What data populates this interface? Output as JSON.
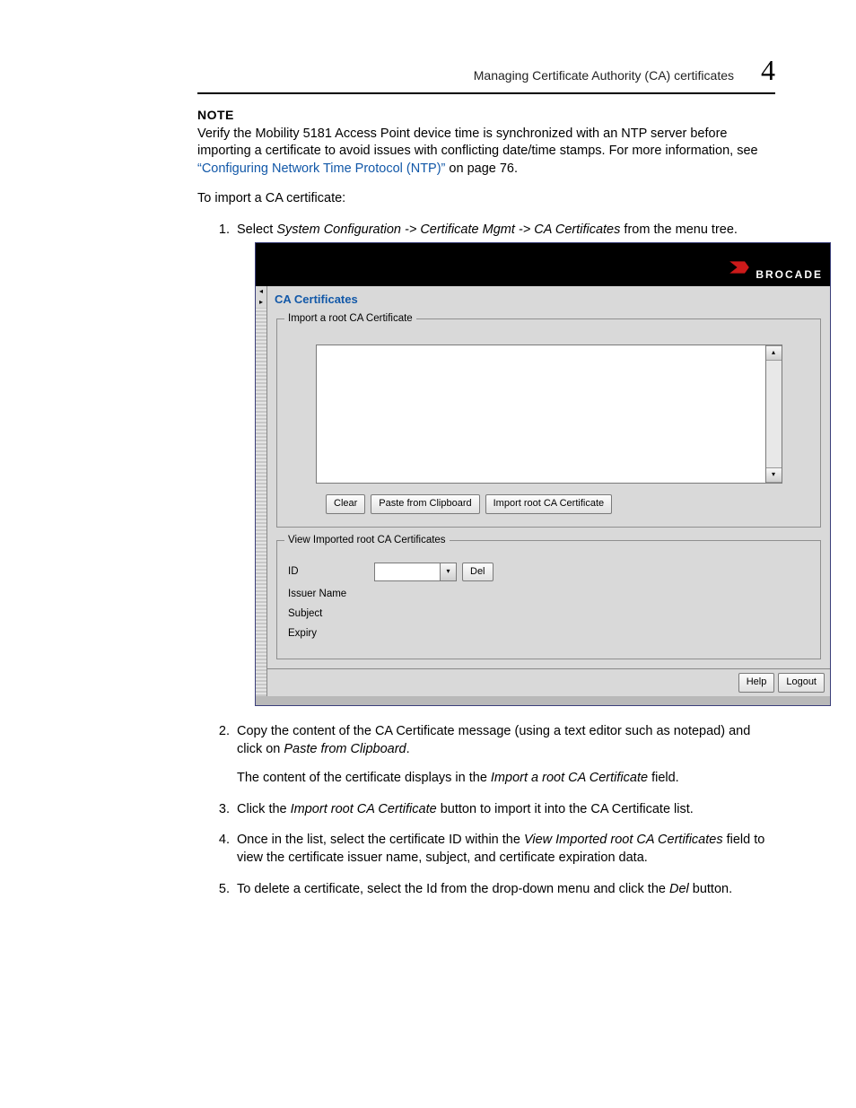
{
  "header": {
    "running_title": "Managing Certificate Authority (CA) certificates",
    "chapter_number": "4"
  },
  "note": {
    "label": "NOTE",
    "text": "Verify the Mobility 5181 Access Point device time is synchronized with an NTP server before importing a certificate to avoid issues with conflicting date/time stamps. For more information, see ",
    "link_text": "“Configuring Network Time Protocol (NTP)”",
    "text_after_link": " on page 76."
  },
  "intro": "To import a CA certificate:",
  "step1": {
    "prefix": "Select ",
    "italic": "System Configuration -> Certificate Mgmt -> CA Certificates",
    "suffix": " from the menu tree."
  },
  "app": {
    "brand": "BROCADE",
    "panel_title": "CA Certificates",
    "import_legend": "Import a root CA Certificate",
    "textarea_value": "",
    "buttons": {
      "clear": "Clear",
      "paste": "Paste from Clipboard",
      "import": "Import root CA Certificate"
    },
    "view_legend": "View Imported root CA Certificates",
    "rows": {
      "id_label": "ID",
      "id_value": "",
      "del": "Del",
      "issuer_label": "Issuer Name",
      "subject_label": "Subject",
      "expiry_label": "Expiry"
    },
    "footer": {
      "help": "Help",
      "logout": "Logout"
    }
  },
  "step2": {
    "main_a": "Copy the content of the CA Certificate message (using a text editor such as notepad) and click on ",
    "italic": "Paste from Clipboard",
    "main_b": ".",
    "sub_a": "The content of the certificate displays in the ",
    "sub_italic": "Import a root CA Certificate",
    "sub_b": " field."
  },
  "step3": {
    "a": "Click the ",
    "italic": "Import root CA Certificate",
    "b": " button to import it into the CA Certificate list."
  },
  "step4": {
    "a": "Once in the list, select the certificate ID within the ",
    "italic": "View Imported root CA Certificates",
    "b": " field to view the certificate issuer name, subject, and certificate expiration data."
  },
  "step5": {
    "a": "To delete a certificate, select the Id from the drop-down menu and click the ",
    "italic": "Del",
    "b": " button."
  }
}
